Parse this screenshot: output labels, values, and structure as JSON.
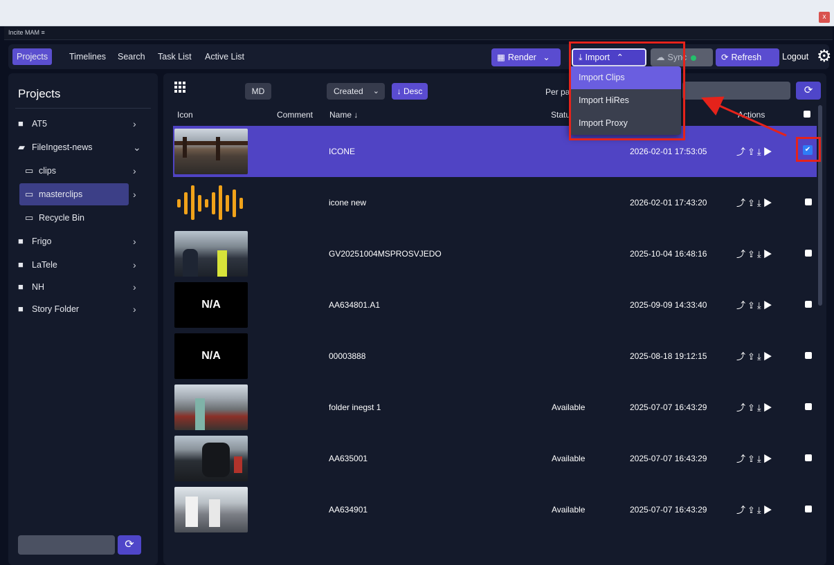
{
  "app": {
    "title": "Incite MAM",
    "menu_glyph": "≡",
    "close_glyph": "x"
  },
  "nav": {
    "tabs": [
      "Projects",
      "Timelines",
      "Search",
      "Task List",
      "Active List"
    ]
  },
  "toolbar": {
    "render": "Render",
    "import": "Import",
    "sync": "Sync",
    "refresh": "Refresh",
    "logout": "Logout"
  },
  "import_menu": {
    "items": [
      "Import Clips",
      "Import HiRes",
      "Import Proxy"
    ]
  },
  "sidebar": {
    "title": "Projects",
    "items": [
      {
        "label": "AT5",
        "icon": "folder-icon"
      },
      {
        "label": "FileIngest-news",
        "icon": "folder-open-icon"
      },
      {
        "label": "clips",
        "icon": "folder-outline-icon"
      },
      {
        "label": "masterclips",
        "icon": "folder-outline-icon"
      },
      {
        "label": "Recycle Bin",
        "icon": "folder-outline-icon"
      },
      {
        "label": "Frigo",
        "icon": "folder-icon"
      },
      {
        "label": "LaTele",
        "icon": "folder-icon"
      },
      {
        "label": "NH",
        "icon": "folder-icon"
      },
      {
        "label": "Story Folder",
        "icon": "folder-icon"
      }
    ]
  },
  "main": {
    "md_label": "MD",
    "sort_value": "Created",
    "desc_label": "↓ Desc",
    "per_page_label": "Per pag",
    "columns": {
      "icon": "Icon",
      "comment": "Comment",
      "name": "Name ↓",
      "status": "Statu",
      "actions": "Actions"
    },
    "rows": [
      {
        "name": "ICONE",
        "status": "",
        "date": "2026-02-01 17:53:05",
        "thumb": "bridge",
        "selected": true
      },
      {
        "name": "icone new",
        "status": "",
        "date": "2026-02-01 17:43:20",
        "thumb": "audio",
        "selected": false
      },
      {
        "name": "GV20251004MSPROSVJEDO",
        "status": "",
        "date": "2025-10-04 16:48:16",
        "thumb": "police",
        "selected": false
      },
      {
        "name": "AA634801.A1",
        "status": "",
        "date": "2025-09-09 14:33:40",
        "thumb": "N/A",
        "selected": false
      },
      {
        "name": "00003888",
        "status": "",
        "date": "2025-08-18 19:12:15",
        "thumb": "N/A",
        "selected": false
      },
      {
        "name": "folder inegst 1",
        "status": "Available",
        "date": "2025-07-07 16:43:29",
        "thumb": "crowd",
        "selected": false
      },
      {
        "name": "AA635001",
        "status": "Available",
        "date": "2025-07-07 16:43:29",
        "thumb": "tractor",
        "selected": false
      },
      {
        "name": "AA634901",
        "status": "Available",
        "date": "2025-07-07 16:43:29",
        "thumb": "parade",
        "selected": false
      }
    ],
    "na_text": "N/A",
    "action_glyphs": "⤴⇪⤓▶"
  },
  "colors": {
    "accent": "#5a4cd0",
    "selected_row": "#5044c4",
    "highlight": "#e5231b",
    "sync_dot": "#24c06b"
  }
}
